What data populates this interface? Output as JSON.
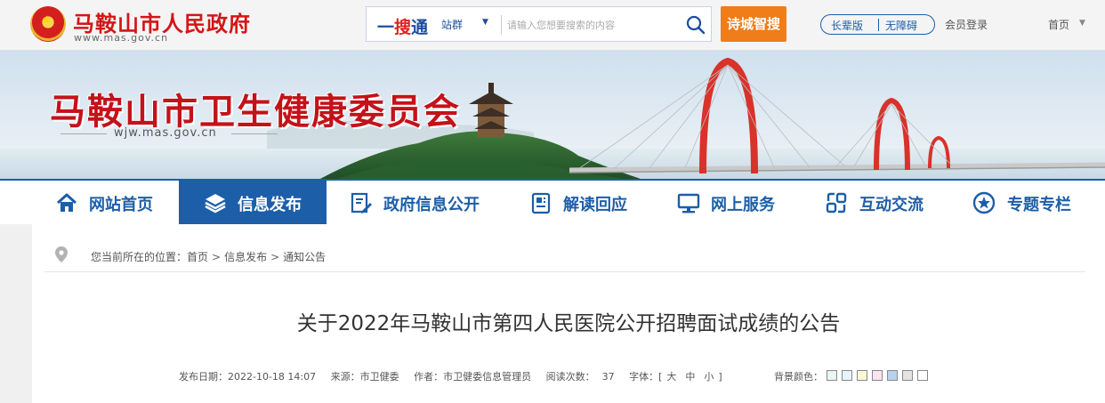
{
  "header": {
    "site_name": "马鞍山市人民政府",
    "site_url": "www.mas.gov.cn",
    "search": {
      "brand_prefix": "一",
      "brand_mid": "搜",
      "brand_suffix": "通",
      "scope": "站群",
      "placeholder": "请输入您想要搜索的内容"
    },
    "poet_city_button": "诗城智搜",
    "accessibility": {
      "elder": "长辈版",
      "barrier_free": "无障碍"
    },
    "login": "会员登录",
    "home": "首页"
  },
  "banner": {
    "dept_name": "马鞍山市卫生健康委员会",
    "dept_url": "wjw.mas.gov.cn"
  },
  "nav": {
    "items": [
      {
        "label": "网站首页",
        "icon": "home-icon"
      },
      {
        "label": "信息发布",
        "icon": "layers-icon",
        "active": true
      },
      {
        "label": "政府信息公开",
        "icon": "document-edit-icon"
      },
      {
        "label": "解读回应",
        "icon": "book-icon"
      },
      {
        "label": "网上服务",
        "icon": "monitor-icon"
      },
      {
        "label": "互动交流",
        "icon": "link-icon"
      },
      {
        "label": "专题专栏",
        "icon": "star-icon"
      }
    ]
  },
  "breadcrumb": {
    "prefix": "您当前所在的位置：",
    "items": [
      "首页",
      "信息发布",
      "通知公告"
    ],
    "separator": ">"
  },
  "article": {
    "title": "关于2022年马鞍山市第四人民医院公开招聘面试成绩的公告",
    "publish_label": "发布日期：",
    "publish_date": "2022-10-18 14:07",
    "source_label": "来源：",
    "source": "市卫健委",
    "author_label": "作者：",
    "author": "市卫健委信息管理员",
    "views_label": "阅读次数：",
    "views": "37",
    "font_label": "字体：",
    "font_open": "[",
    "font_large": "大",
    "font_medium": "中",
    "font_small": "小",
    "font_close": "]",
    "bg_label": "背景颜色：",
    "bg_colors": [
      "#e8f7f0",
      "#e6f5fb",
      "#fbf8d8",
      "#fbe3f2",
      "#b8d3ec",
      "#e3e3e3",
      "#ffffff"
    ]
  },
  "colors": {
    "brand_red": "#d21616",
    "brand_blue": "#1d5ea8",
    "accent_orange": "#ef7d1a"
  }
}
